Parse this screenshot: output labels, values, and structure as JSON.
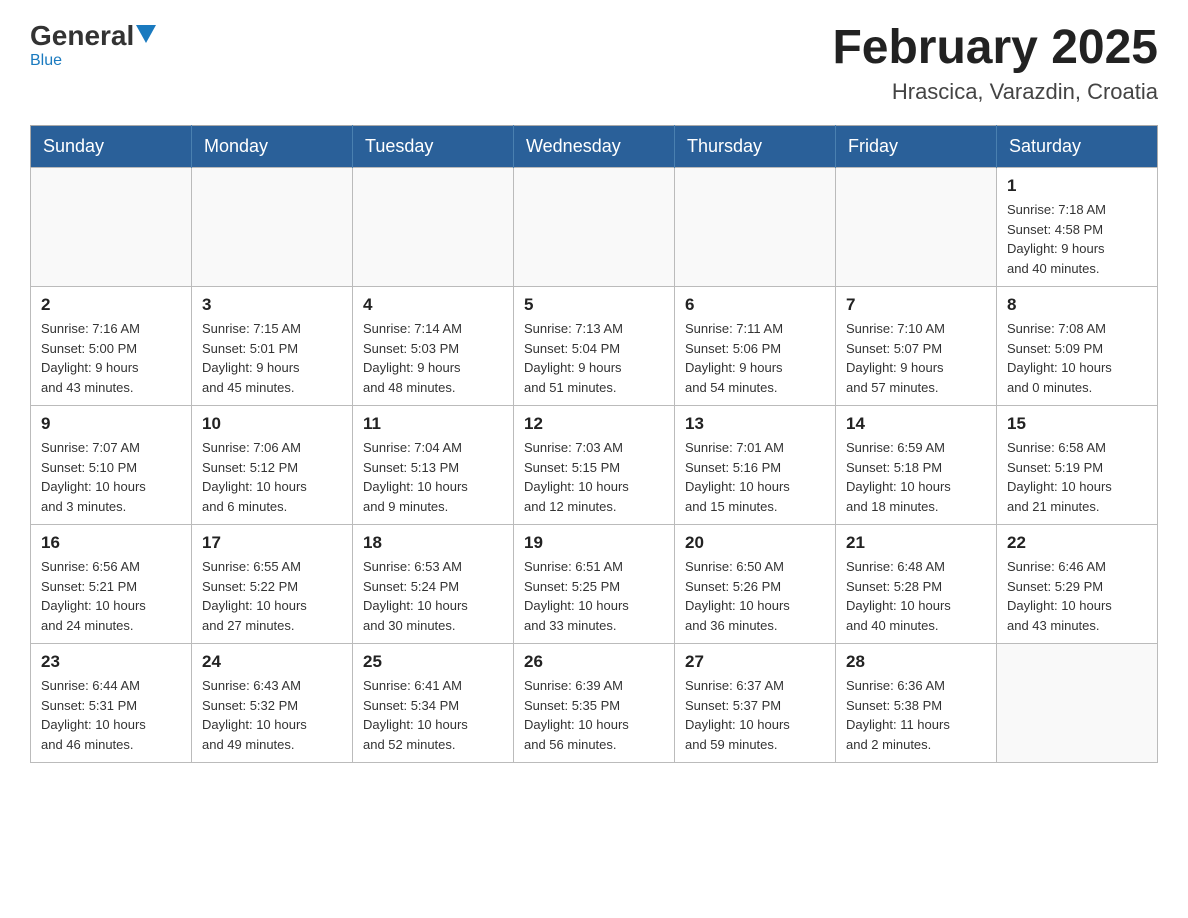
{
  "header": {
    "logo_general": "General",
    "logo_blue": "Blue",
    "month_title": "February 2025",
    "location": "Hrascica, Varazdin, Croatia"
  },
  "days_of_week": [
    "Sunday",
    "Monday",
    "Tuesday",
    "Wednesday",
    "Thursday",
    "Friday",
    "Saturday"
  ],
  "weeks": [
    [
      {
        "day": "",
        "info": ""
      },
      {
        "day": "",
        "info": ""
      },
      {
        "day": "",
        "info": ""
      },
      {
        "day": "",
        "info": ""
      },
      {
        "day": "",
        "info": ""
      },
      {
        "day": "",
        "info": ""
      },
      {
        "day": "1",
        "info": "Sunrise: 7:18 AM\nSunset: 4:58 PM\nDaylight: 9 hours\nand 40 minutes."
      }
    ],
    [
      {
        "day": "2",
        "info": "Sunrise: 7:16 AM\nSunset: 5:00 PM\nDaylight: 9 hours\nand 43 minutes."
      },
      {
        "day": "3",
        "info": "Sunrise: 7:15 AM\nSunset: 5:01 PM\nDaylight: 9 hours\nand 45 minutes."
      },
      {
        "day": "4",
        "info": "Sunrise: 7:14 AM\nSunset: 5:03 PM\nDaylight: 9 hours\nand 48 minutes."
      },
      {
        "day": "5",
        "info": "Sunrise: 7:13 AM\nSunset: 5:04 PM\nDaylight: 9 hours\nand 51 minutes."
      },
      {
        "day": "6",
        "info": "Sunrise: 7:11 AM\nSunset: 5:06 PM\nDaylight: 9 hours\nand 54 minutes."
      },
      {
        "day": "7",
        "info": "Sunrise: 7:10 AM\nSunset: 5:07 PM\nDaylight: 9 hours\nand 57 minutes."
      },
      {
        "day": "8",
        "info": "Sunrise: 7:08 AM\nSunset: 5:09 PM\nDaylight: 10 hours\nand 0 minutes."
      }
    ],
    [
      {
        "day": "9",
        "info": "Sunrise: 7:07 AM\nSunset: 5:10 PM\nDaylight: 10 hours\nand 3 minutes."
      },
      {
        "day": "10",
        "info": "Sunrise: 7:06 AM\nSunset: 5:12 PM\nDaylight: 10 hours\nand 6 minutes."
      },
      {
        "day": "11",
        "info": "Sunrise: 7:04 AM\nSunset: 5:13 PM\nDaylight: 10 hours\nand 9 minutes."
      },
      {
        "day": "12",
        "info": "Sunrise: 7:03 AM\nSunset: 5:15 PM\nDaylight: 10 hours\nand 12 minutes."
      },
      {
        "day": "13",
        "info": "Sunrise: 7:01 AM\nSunset: 5:16 PM\nDaylight: 10 hours\nand 15 minutes."
      },
      {
        "day": "14",
        "info": "Sunrise: 6:59 AM\nSunset: 5:18 PM\nDaylight: 10 hours\nand 18 minutes."
      },
      {
        "day": "15",
        "info": "Sunrise: 6:58 AM\nSunset: 5:19 PM\nDaylight: 10 hours\nand 21 minutes."
      }
    ],
    [
      {
        "day": "16",
        "info": "Sunrise: 6:56 AM\nSunset: 5:21 PM\nDaylight: 10 hours\nand 24 minutes."
      },
      {
        "day": "17",
        "info": "Sunrise: 6:55 AM\nSunset: 5:22 PM\nDaylight: 10 hours\nand 27 minutes."
      },
      {
        "day": "18",
        "info": "Sunrise: 6:53 AM\nSunset: 5:24 PM\nDaylight: 10 hours\nand 30 minutes."
      },
      {
        "day": "19",
        "info": "Sunrise: 6:51 AM\nSunset: 5:25 PM\nDaylight: 10 hours\nand 33 minutes."
      },
      {
        "day": "20",
        "info": "Sunrise: 6:50 AM\nSunset: 5:26 PM\nDaylight: 10 hours\nand 36 minutes."
      },
      {
        "day": "21",
        "info": "Sunrise: 6:48 AM\nSunset: 5:28 PM\nDaylight: 10 hours\nand 40 minutes."
      },
      {
        "day": "22",
        "info": "Sunrise: 6:46 AM\nSunset: 5:29 PM\nDaylight: 10 hours\nand 43 minutes."
      }
    ],
    [
      {
        "day": "23",
        "info": "Sunrise: 6:44 AM\nSunset: 5:31 PM\nDaylight: 10 hours\nand 46 minutes."
      },
      {
        "day": "24",
        "info": "Sunrise: 6:43 AM\nSunset: 5:32 PM\nDaylight: 10 hours\nand 49 minutes."
      },
      {
        "day": "25",
        "info": "Sunrise: 6:41 AM\nSunset: 5:34 PM\nDaylight: 10 hours\nand 52 minutes."
      },
      {
        "day": "26",
        "info": "Sunrise: 6:39 AM\nSunset: 5:35 PM\nDaylight: 10 hours\nand 56 minutes."
      },
      {
        "day": "27",
        "info": "Sunrise: 6:37 AM\nSunset: 5:37 PM\nDaylight: 10 hours\nand 59 minutes."
      },
      {
        "day": "28",
        "info": "Sunrise: 6:36 AM\nSunset: 5:38 PM\nDaylight: 11 hours\nand 2 minutes."
      },
      {
        "day": "",
        "info": ""
      }
    ]
  ]
}
